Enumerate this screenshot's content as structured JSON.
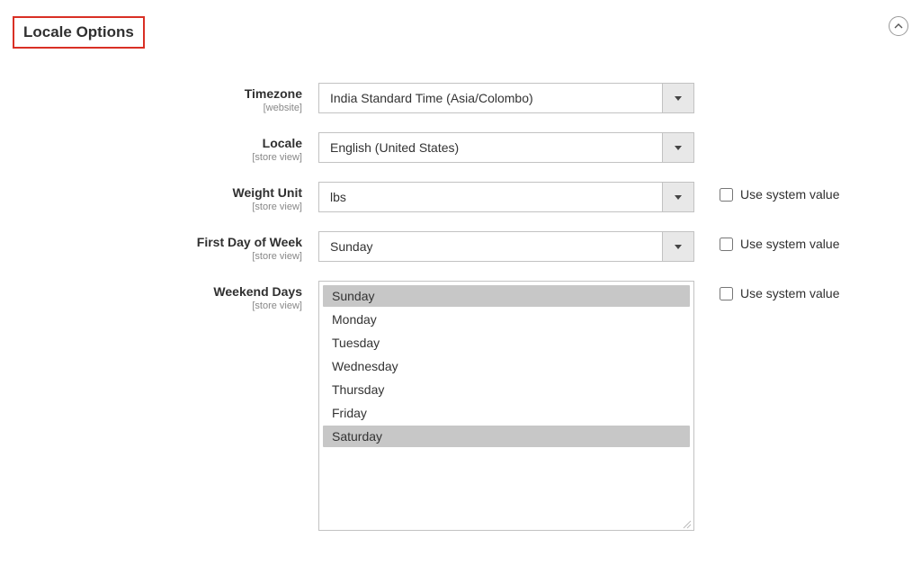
{
  "section": {
    "title": "Locale Options"
  },
  "checkbox_label": "Use system value",
  "fields": {
    "timezone": {
      "label": "Timezone",
      "scope": "[website]",
      "value": "India Standard Time (Asia/Colombo)"
    },
    "locale": {
      "label": "Locale",
      "scope": "[store view]",
      "value": "English (United States)"
    },
    "weight_unit": {
      "label": "Weight Unit",
      "scope": "[store view]",
      "value": "lbs"
    },
    "first_day": {
      "label": "First Day of Week",
      "scope": "[store view]",
      "value": "Sunday"
    },
    "weekend_days": {
      "label": "Weekend Days",
      "scope": "[store view]",
      "options": {
        "0": "Sunday",
        "1": "Monday",
        "2": "Tuesday",
        "3": "Wednesday",
        "4": "Thursday",
        "5": "Friday",
        "6": "Saturday"
      },
      "selected": [
        "0",
        "6"
      ]
    }
  }
}
